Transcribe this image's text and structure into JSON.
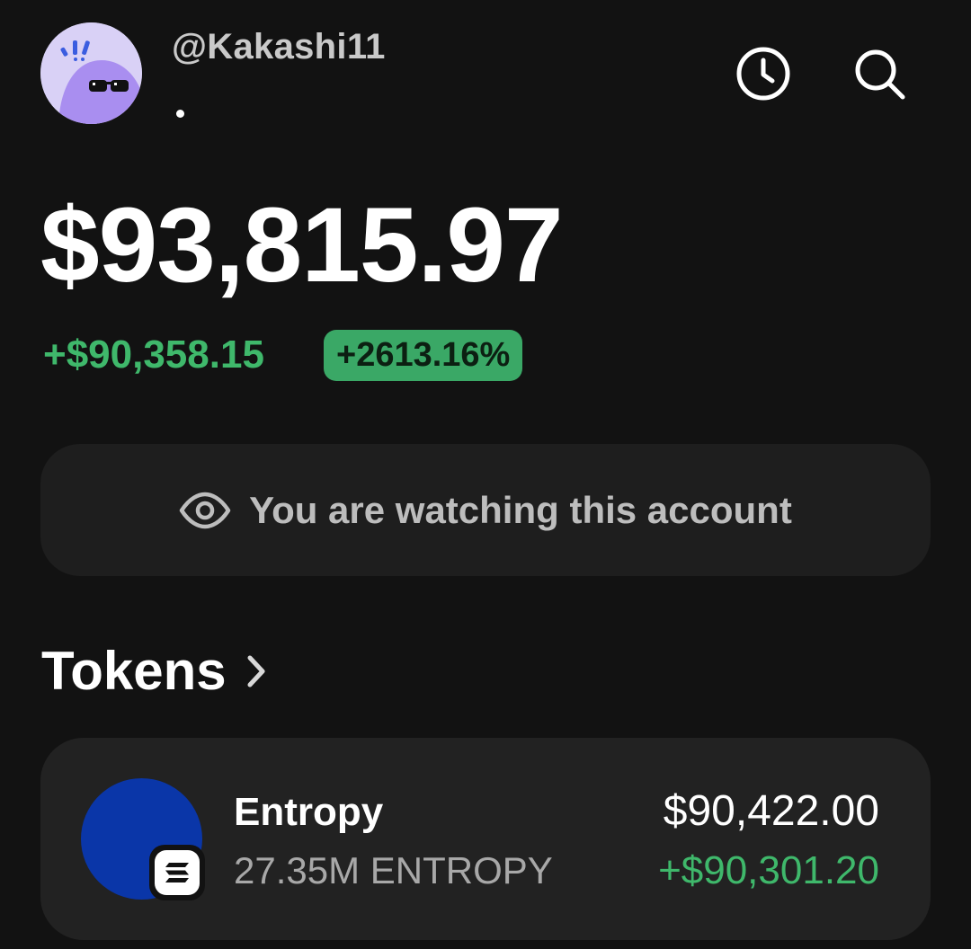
{
  "header": {
    "username": "@Kakashi11",
    "avatar_icon": "cool-blob-avatar",
    "history_icon": "clock-icon",
    "search_icon": "search-icon"
  },
  "balance": {
    "total": "$93,815.97",
    "change_amount": "+$90,358.15",
    "change_percent": "+2613.16%"
  },
  "watch_banner": {
    "icon": "eye-icon",
    "text": "You are watching this account"
  },
  "tokens": {
    "section_title": "Tokens",
    "chevron_icon": "chevron-right-icon",
    "items": [
      {
        "name": "Entropy",
        "amount": "27.35M ENTROPY",
        "value": "$90,422.00",
        "change": "+$90,301.20",
        "chain_icon": "solana-icon"
      }
    ]
  },
  "colors": {
    "background": "#121212",
    "card": "#222222",
    "positive": "#3fb86b",
    "token_logo": "#0a36a8",
    "avatar_bg": "#d9d1f6"
  }
}
